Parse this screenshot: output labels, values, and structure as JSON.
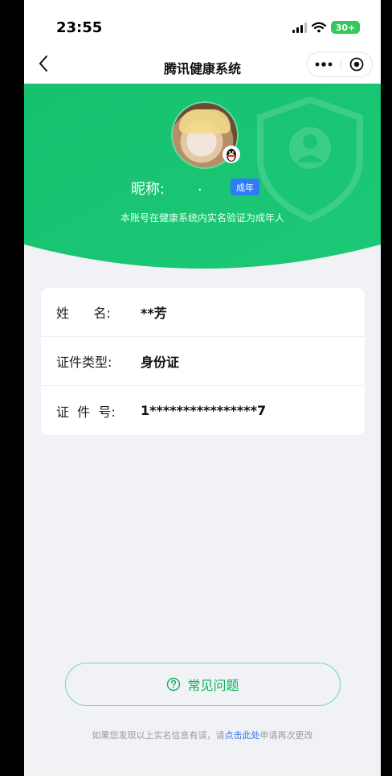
{
  "status_bar": {
    "time": "23:55",
    "battery": "30+"
  },
  "nav": {
    "title": "腾讯健康系统"
  },
  "profile": {
    "nickname_label": "昵称:",
    "nickname_value": ".",
    "age_badge": "成年",
    "description": "本账号在健康系统内实名验证为成年人"
  },
  "info": {
    "rows": [
      {
        "label": "姓      名:",
        "value": "**芳"
      },
      {
        "label": "证件类型:",
        "value": "身份证"
      },
      {
        "label": "证  件  号:",
        "value": "1****************7"
      }
    ]
  },
  "faq": {
    "label": "常见问题"
  },
  "footer": {
    "prefix": "如果您发现以上实名信息有误，请",
    "link": "点击此处",
    "suffix": "申请再次更改"
  },
  "colors": {
    "brand_green": "#17c36f",
    "link_blue": "#3b73e8",
    "badge_blue": "#2f7bf5"
  }
}
